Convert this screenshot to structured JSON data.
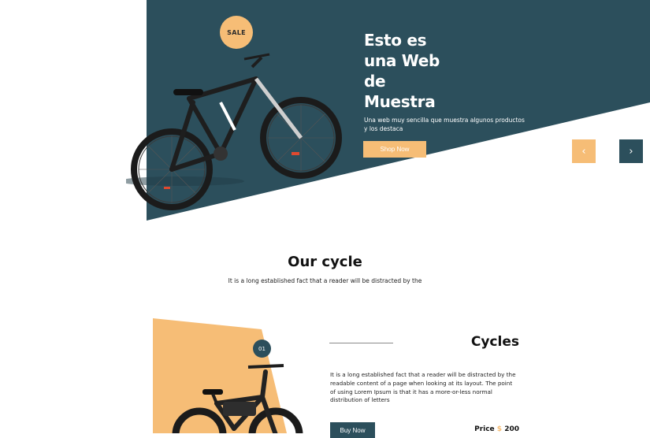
{
  "colors": {
    "teal": "#2c4f5c",
    "accent": "#f6bd76",
    "background": "#ffffff"
  },
  "hero": {
    "badge": "SALE",
    "title_lines": [
      "Esto es",
      "una Web",
      "de",
      "Muestra"
    ],
    "subtitle": "Una web muy sencilla que muestra algunos productos y los destaca",
    "shop_button": "Shop Now",
    "prev_icon": "‹",
    "next_icon": "›"
  },
  "section": {
    "title": "Our cycle",
    "subtitle": "It is a long established fact that a reader will be distracted by the"
  },
  "product": {
    "number": "01",
    "title": "Cycles",
    "description": "It is a long established fact that a reader will be distracted by the readable content of a page when looking at its layout. The point of using Lorem Ipsum is that it has a more-or-less normal distribution of letters",
    "buy_button": "Buy Now",
    "price_label": "Price",
    "price_currency": "$",
    "price_value": "200"
  }
}
